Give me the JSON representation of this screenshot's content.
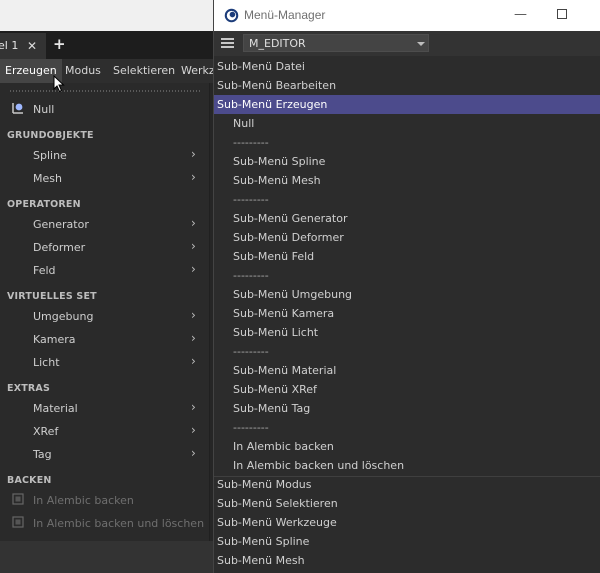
{
  "c4d": {
    "tab_label": "el 1",
    "tab_close": "✕",
    "new_tab": "+",
    "menubar": [
      "Erzeugen",
      "Modus",
      "Selektieren",
      "Werkze"
    ],
    "dropdown": {
      "null_label": "Null",
      "sections": [
        {
          "heading": "GRUNDOBJEKTE",
          "items": [
            "Spline",
            "Mesh"
          ]
        },
        {
          "heading": "OPERATOREN",
          "items": [
            "Generator",
            "Deformer",
            "Feld"
          ]
        },
        {
          "heading": "VIRTUELLES SET",
          "items": [
            "Umgebung",
            "Kamera",
            "Licht"
          ]
        },
        {
          "heading": "EXTRAS",
          "items": [
            "Material",
            "XRef",
            "Tag"
          ]
        },
        {
          "heading": "BACKEN",
          "items": [
            "In Alembic backen",
            "In Alembic backen und löschen"
          ]
        }
      ],
      "chevron": "›"
    }
  },
  "menu_manager": {
    "title": "Menü-Manager",
    "minimize": "—",
    "selected_menu": "M_EDITOR",
    "items": [
      "Sub-Menü Datei",
      "Sub-Menü Bearbeiten",
      "Sub-Menü Erzeugen",
      "Null",
      "---------",
      "Sub-Menü Spline",
      "Sub-Menü Mesh",
      "---------",
      "Sub-Menü Generator",
      "Sub-Menü Deformer",
      "Sub-Menü Feld",
      "---------",
      "Sub-Menü Umgebung",
      "Sub-Menü Kamera",
      "Sub-Menü Licht",
      "---------",
      "Sub-Menü Material",
      "Sub-Menü XRef",
      "Sub-Menü Tag",
      "---------",
      "In Alembic backen",
      "In Alembic backen und löschen",
      "Sub-Menü Modus",
      "Sub-Menü Selektieren",
      "Sub-Menü Werkzeuge",
      "Sub-Menü Spline",
      "Sub-Menü Mesh"
    ],
    "selected_item": "Sub-Menü Erzeugen"
  },
  "colors": {
    "selection": "#4c4b8c",
    "background": "#2b2b2b",
    "text": "#d0d0d0"
  }
}
